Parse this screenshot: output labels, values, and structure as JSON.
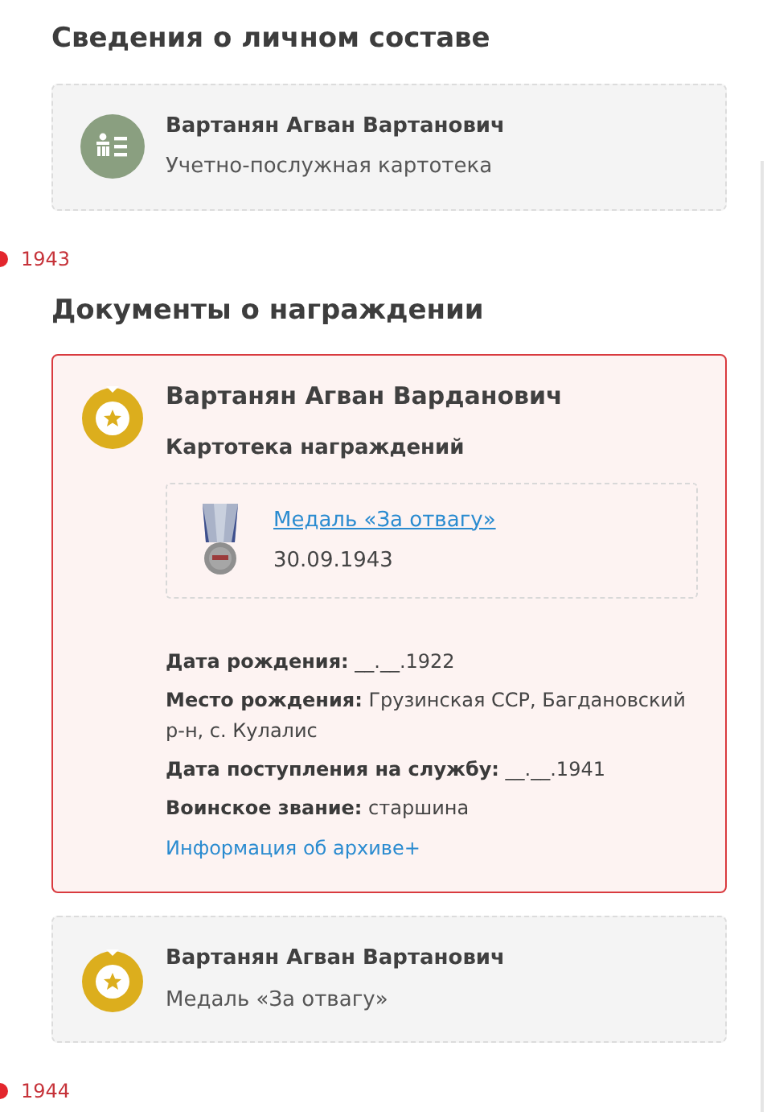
{
  "blocks": [
    {
      "kind": "section",
      "title": "Сведения о личном составе",
      "cards": [
        {
          "kind": "personnel",
          "expanded": false,
          "name": "Вартанян Агван Вартанович",
          "subtitle": "Учетно-послужная картотека"
        }
      ]
    },
    {
      "kind": "year",
      "year": "1943"
    },
    {
      "kind": "section",
      "title": "Документы о награждении",
      "cards": [
        {
          "kind": "award",
          "expanded": true,
          "name": "Вартанян Агван Варданович",
          "subtitle": "Картотека награждений",
          "award": {
            "link": "Медаль «За отвагу»",
            "date": "30.09.1943"
          },
          "fields": [
            {
              "label": "Дата рождения:",
              "value": "__.__.1922"
            },
            {
              "label": "Место рождения:",
              "value": "Грузинская ССР, Багдановский р-н, с. Кулалис"
            },
            {
              "label": "Дата поступления на службу:",
              "value": "__.__.1941"
            },
            {
              "label": "Воинское звание:",
              "value": "старшина"
            }
          ],
          "archive_link": "Информация об архиве+"
        },
        {
          "kind": "award",
          "expanded": false,
          "name": "Вартанян Агван Вартанович",
          "subtitle": "Медаль «За отвагу»"
        }
      ]
    },
    {
      "kind": "year",
      "year": "1944"
    }
  ]
}
